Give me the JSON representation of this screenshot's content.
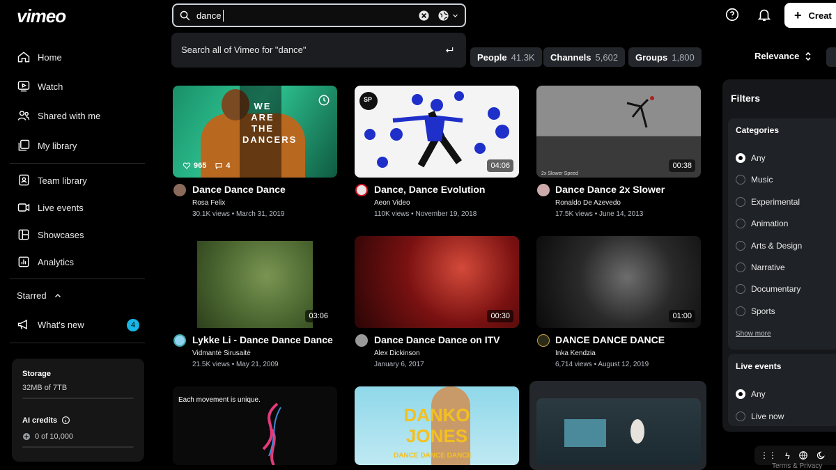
{
  "app": {
    "logo": "vimeo"
  },
  "sidebar": {
    "items": [
      {
        "label": "Home",
        "icon": "home-icon"
      },
      {
        "label": "Watch",
        "icon": "play-screen-icon"
      },
      {
        "label": "Shared with me",
        "icon": "people-icon"
      },
      {
        "label": "My library",
        "icon": "library-icon"
      },
      {
        "label": "Team library",
        "icon": "team-library-icon"
      },
      {
        "label": "Live events",
        "icon": "camera-icon"
      },
      {
        "label": "Showcases",
        "icon": "showcase-icon"
      },
      {
        "label": "Analytics",
        "icon": "analytics-icon"
      }
    ],
    "starred_label": "Starred",
    "whats_new_label": "What's new",
    "whats_new_badge": "4",
    "storage": {
      "label": "Storage",
      "value": "32MB of 7TB",
      "ai_label": "AI credits",
      "ai_value": "0 of 10,000"
    }
  },
  "search": {
    "value": "dance",
    "suggestion": "Search all of Vimeo for \"dance\""
  },
  "chips": [
    {
      "label": "People",
      "count": "41.3K"
    },
    {
      "label": "Channels",
      "count": "5,602"
    },
    {
      "label": "Groups",
      "count": "1,800"
    }
  ],
  "sort": {
    "label": "Relevance"
  },
  "header": {
    "create_label": "Creat"
  },
  "videos": [
    {
      "title": "Dance Dance Dance",
      "author": "Rosa Felix",
      "meta": "30.1K views • March 31, 2019",
      "likes": "965",
      "comments": "4",
      "thumb_text": "WE ARE THE DANCERS",
      "color": "#2aa77a"
    },
    {
      "title": "Dance, Dance Evolution",
      "author": "Aeon Video",
      "meta": "110K views • November 19, 2018",
      "duration": "04:06",
      "color": "#1f2fc9"
    },
    {
      "title": "Dance Dance 2x Slower",
      "author": "Ronaldo De Azevedo",
      "meta": "17.5K views • June 14, 2013",
      "duration": "00:38",
      "caption": "2x Slower Speed",
      "color": "#8a8a8a"
    },
    {
      "title": "Lykke Li - Dance Dance Dance",
      "author": "Vidmantė Sirusaitė",
      "meta": "21.5K views • May 21, 2009",
      "duration": "03:06",
      "color": "#4f6a2f"
    },
    {
      "title": "Dance Dance Dance on ITV",
      "author": "Alex Dickinson",
      "meta": "January 6, 2017",
      "duration": "00:30",
      "color": "#7a1111"
    },
    {
      "title": "DANCE DANCE DANCE",
      "author": "Inka Kendzia",
      "meta": "6,714 views • August 12, 2019",
      "duration": "01:00",
      "color": "#2a2a2a"
    },
    {
      "title": "",
      "author": "",
      "meta": "",
      "thumb_text": "Each movement is unique.",
      "color": "#0a0a0a"
    },
    {
      "title": "",
      "author": "",
      "meta": "",
      "thumb_text": "DANKO JONES",
      "thumb_sub": "DANCE DANCE DANCE",
      "color": "#7fd4e8"
    },
    {
      "title": "",
      "author": "",
      "meta": "",
      "color": "#1d2a30"
    }
  ],
  "filters": {
    "title": "Filters",
    "categories_label": "Categories",
    "categories": [
      "Any",
      "Music",
      "Experimental",
      "Animation",
      "Arts & Design",
      "Narrative",
      "Documentary",
      "Sports"
    ],
    "show_more": "Show more",
    "live_label": "Live events",
    "live_options": [
      "Any",
      "Live now"
    ]
  },
  "footer": {
    "text": "Terms & Privacy"
  }
}
